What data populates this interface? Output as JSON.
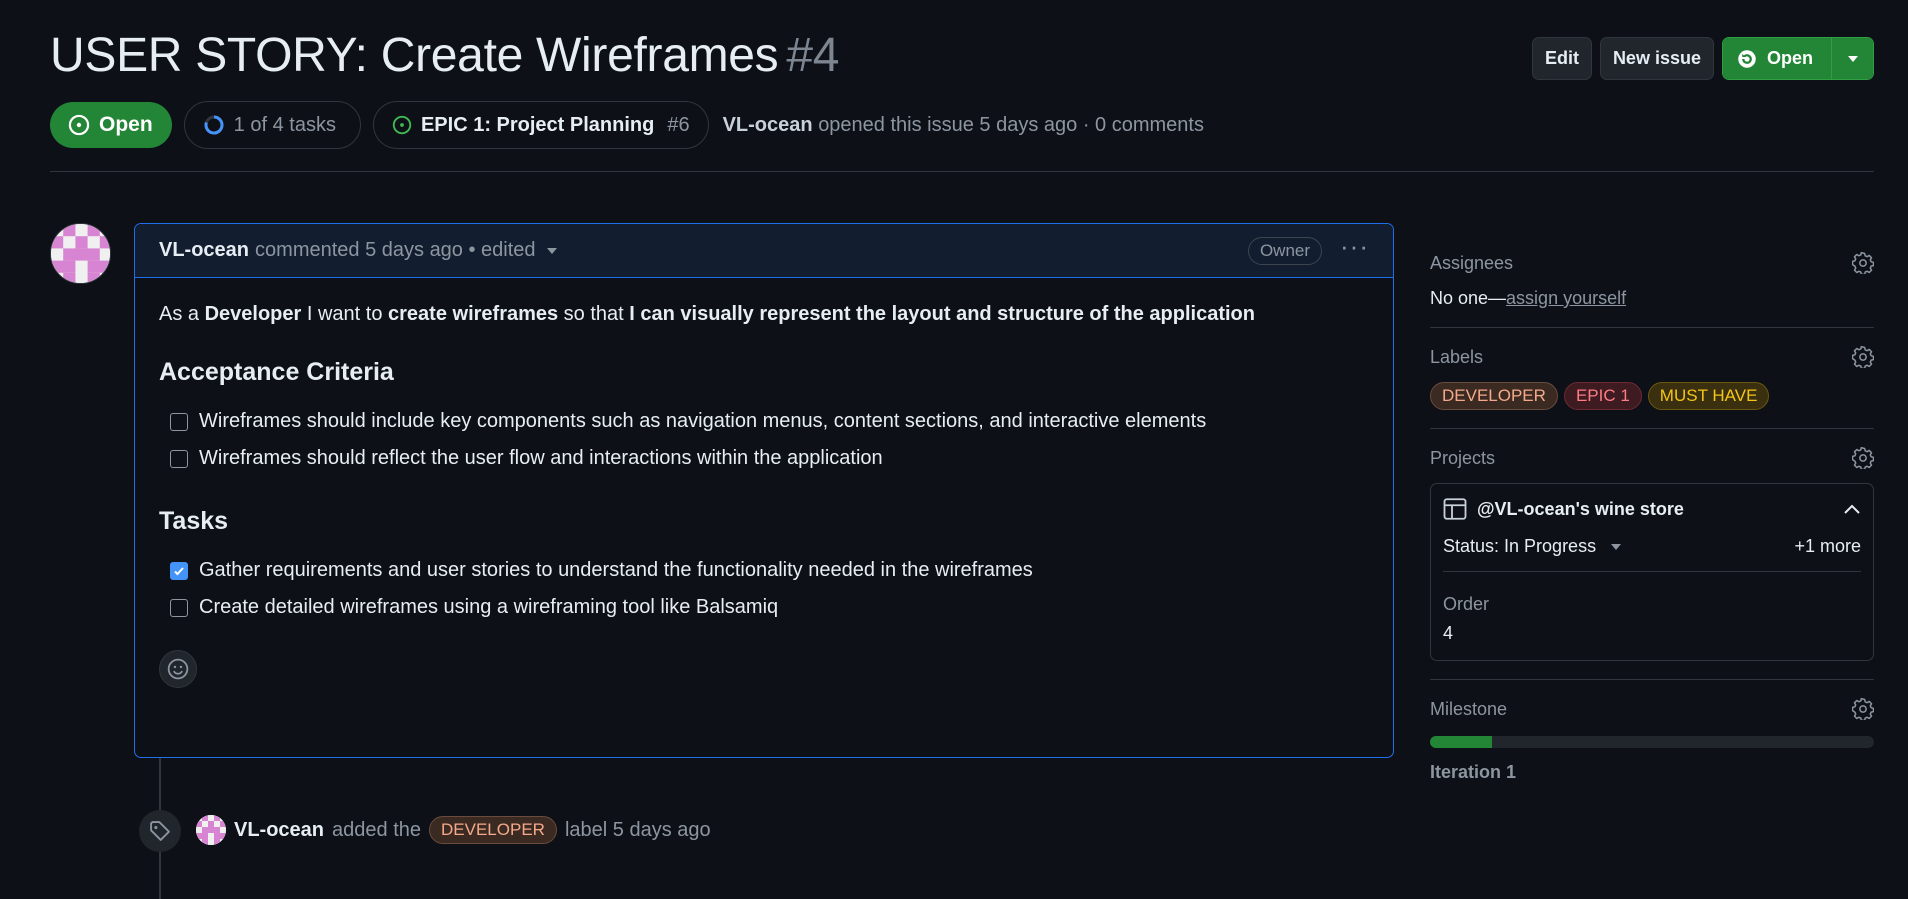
{
  "issue": {
    "title": "USER STORY: Create Wireframes",
    "number": "#4",
    "state": "Open",
    "tasks_summary": "1 of 4 tasks",
    "parent_title": "EPIC 1: Project Planning",
    "parent_number": "#6",
    "author": "VL-ocean",
    "opened_text": "opened this issue 5 days ago · 0 comments"
  },
  "header_buttons": {
    "edit": "Edit",
    "new_issue": "New issue",
    "open": "Open"
  },
  "comment": {
    "author": "VL-ocean",
    "meta": "commented 5 days ago • edited",
    "role_badge": "Owner",
    "intro": {
      "t1": "As a ",
      "b1": "Developer",
      "t2": " I want to ",
      "b2": "create wireframes",
      "t3": " so that ",
      "b3": "I can visually represent the layout and structure of the application"
    },
    "acceptance_heading": "Acceptance Criteria",
    "acceptance": [
      {
        "label": "Wireframes should include key components such as navigation menus, content sections, and interactive elements",
        "checked": false
      },
      {
        "label": "Wireframes should reflect the user flow and interactions within the application",
        "checked": false
      }
    ],
    "tasks_heading": "Tasks",
    "tasks": [
      {
        "label": "Gather requirements and user stories to understand the functionality needed in the wireframes",
        "checked": true
      },
      {
        "label": "Create detailed wireframes using a wireframing tool like Balsamiq",
        "checked": false
      }
    ]
  },
  "timeline_event": {
    "actor": "VL-ocean",
    "action": "added the",
    "label": "DEVELOPER",
    "suffix": "label 5 days ago"
  },
  "sidebar": {
    "assignees": {
      "title": "Assignees",
      "value": "No one—",
      "link": "assign yourself"
    },
    "labels": {
      "title": "Labels",
      "items": [
        {
          "name": "DEVELOPER",
          "color": "#f5a98a"
        },
        {
          "name": "EPIC 1",
          "color": "#ff7b85"
        },
        {
          "name": "MUST HAVE",
          "color": "#f5c518"
        }
      ]
    },
    "projects": {
      "title": "Projects",
      "project_name": "@VL-ocean's wine store",
      "status": "Status: In Progress",
      "more": "+1 more",
      "order_label": "Order",
      "order_value": "4"
    },
    "milestone": {
      "title": "Milestone",
      "name": "Iteration 1",
      "progress": 0.14
    }
  },
  "colors": {
    "background": "#0d1117",
    "accent_green": "#238636",
    "accent_blue": "#1f6feb",
    "muted_text": "#8d96a0"
  }
}
